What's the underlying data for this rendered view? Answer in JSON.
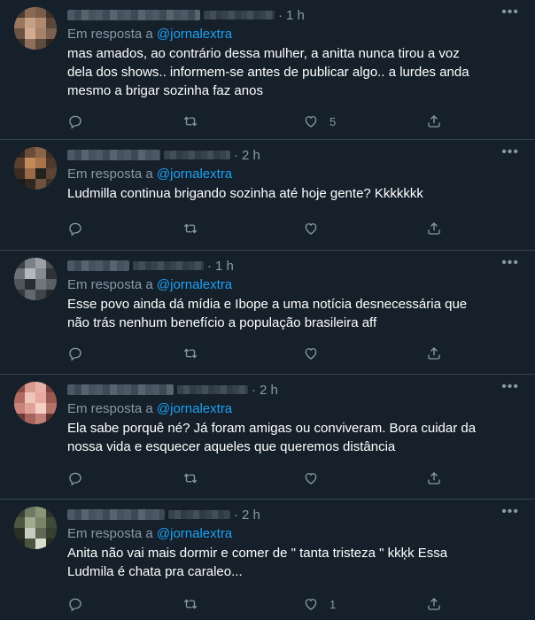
{
  "reply_prefix": "Em resposta a",
  "tweets": [
    {
      "time": "1 h",
      "mention": "@jornalextra",
      "text": "mas amados, ao contrário dessa mulher, a anitta nunca tirou a voz dela dos shows.. informem-se antes de publicar algo.. a lurdes anda mesmo a brigar sozinha faz anos",
      "like_count": "5"
    },
    {
      "time": "2 h",
      "mention": "@jornalextra",
      "text": "Ludmilla continua brigando sozinha até hoje gente? Kkkkkkk",
      "like_count": ""
    },
    {
      "time": "1 h",
      "mention": "@jornalextra",
      "text": "Esse povo ainda dá mídia e Ibope a uma notícia desnecessária que não trás nenhum benefício a população brasileira aff",
      "like_count": ""
    },
    {
      "time": "2 h",
      "mention": "@jornalextra",
      "text": "Ela sabe porquê né? Já foram amigas ou conviveram. Bora cuidar da nossa vida e esquecer aqueles que queremos distância",
      "like_count": ""
    },
    {
      "time": "2 h",
      "mention": "@jornalextra",
      "text": "Anita não vai mais dormir e comer de \" tanta tristeza \" kkķk Essa Ludmila é chata pra caraleo...",
      "like_count": "1"
    }
  ],
  "icons": {
    "reply": "reply-icon",
    "retweet": "retweet-icon",
    "like": "heart-icon",
    "share": "share-icon",
    "more": "more-icon"
  },
  "colors": {
    "background": "#15202b",
    "secondary_text": "#8899a6",
    "link": "#1da1f2",
    "divider": "#38444d"
  }
}
